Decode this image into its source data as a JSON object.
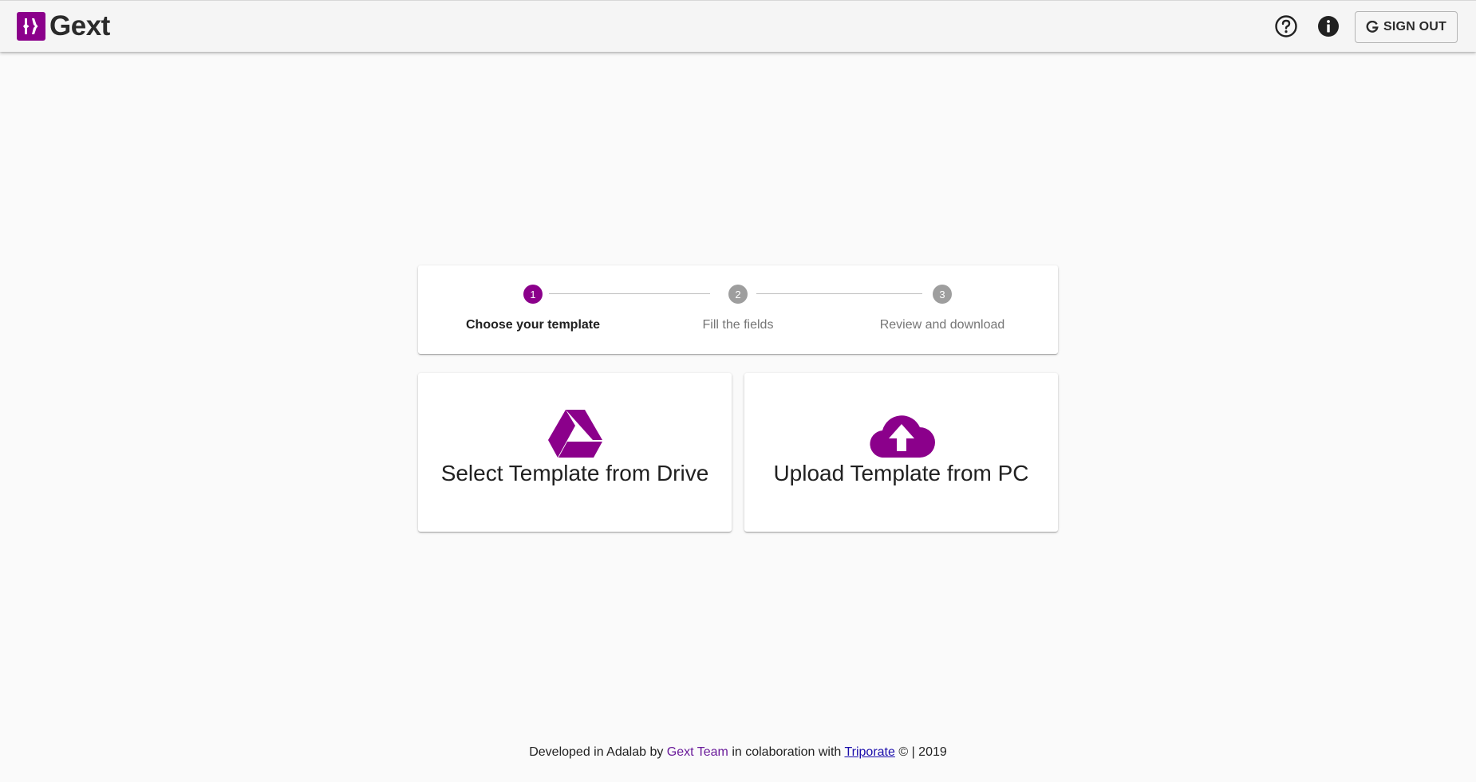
{
  "header": {
    "app_name": "Gext",
    "logo_icon": "gext-logo-icon",
    "help_icon": "help-circle-icon",
    "info_icon": "info-icon",
    "signout_icon": "google-icon",
    "signout_label": "SIGN OUT"
  },
  "stepper": {
    "active_color": "#8b008b",
    "inactive_color": "#9e9e9e",
    "steps": [
      {
        "number": "1",
        "label": "Choose your template",
        "active": true
      },
      {
        "number": "2",
        "label": "Fill the fields",
        "active": false
      },
      {
        "number": "3",
        "label": "Review and download",
        "active": false
      }
    ]
  },
  "options": [
    {
      "label": "Select Template from Drive",
      "icon": "google-drive-icon"
    },
    {
      "label": "Upload Template from PC",
      "icon": "cloud-upload-icon"
    }
  ],
  "accent_color": "#8b008b",
  "footer": {
    "prefix": "Developed in Adalab by",
    "team": "Gext Team",
    "middle": "in colaboration with",
    "partner": "Triporate",
    "suffix": "© | 2019"
  }
}
